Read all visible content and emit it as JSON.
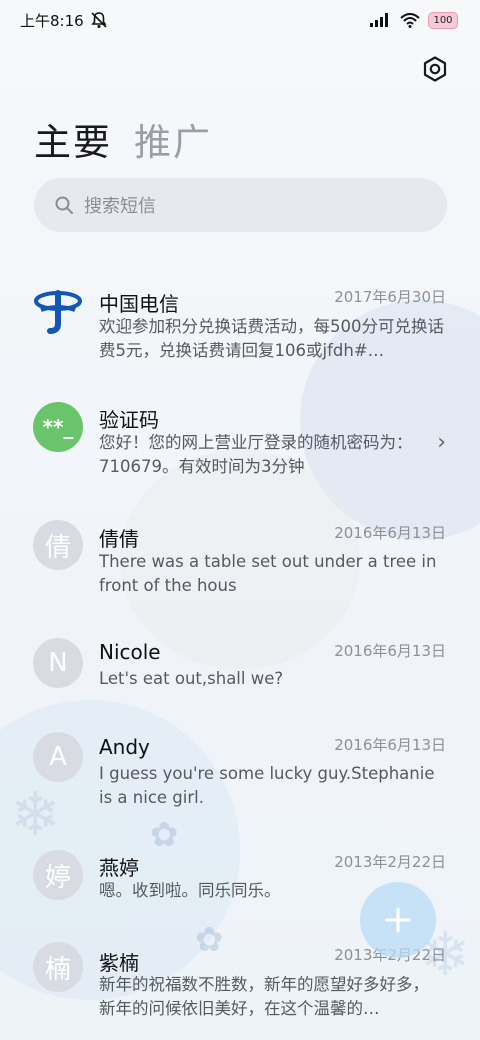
{
  "status_bar": {
    "time": "上午8:16",
    "battery": "100"
  },
  "tabs": [
    {
      "label": "主要"
    },
    {
      "label": "推广"
    }
  ],
  "search": {
    "placeholder": "搜索短信"
  },
  "conversations": [
    {
      "sender": "中国电信",
      "date": "2017年6月30日",
      "preview": "欢迎参加积分兑换话费活动，每500分可兑换话费5元，兑换话费请回复106或jfdh#…",
      "avatar": "",
      "avatar_icon": "china-telecom-logo"
    },
    {
      "sender": "验证码",
      "date": "",
      "preview": "您好！您的网上营业厅登录的随机密码为：710679。有效时间为3分钟",
      "avatar": "**_",
      "avatar_color": "#6ac56a",
      "has_chevron": true
    },
    {
      "sender": "倩倩",
      "date": "2016年6月13日",
      "preview": "There was a table set out under a tree in front of the hous",
      "avatar": "倩"
    },
    {
      "sender": "Nicole",
      "date": "2016年6月13日",
      "preview": "Let's eat out,shall we?",
      "avatar": "N"
    },
    {
      "sender": "Andy",
      "date": "2016年6月13日",
      "preview": "I guess you're some lucky guy.Stephanie is a nice girl.",
      "avatar": "A"
    },
    {
      "sender": "燕婷",
      "date": "2013年2月22日",
      "preview": "嗯。收到啦。同乐同乐。",
      "avatar": "婷"
    },
    {
      "sender": "紫楠",
      "date": "2013年2月22日",
      "preview": "新年的祝福数不胜数，新年的愿望好多好多，新年的问候依旧美好，在这个温馨的…",
      "avatar": "楠"
    }
  ],
  "icons": {
    "settings": "gear-icon",
    "search": "search-icon",
    "compose": "plus-icon",
    "chevron": "chevron-right-icon"
  }
}
